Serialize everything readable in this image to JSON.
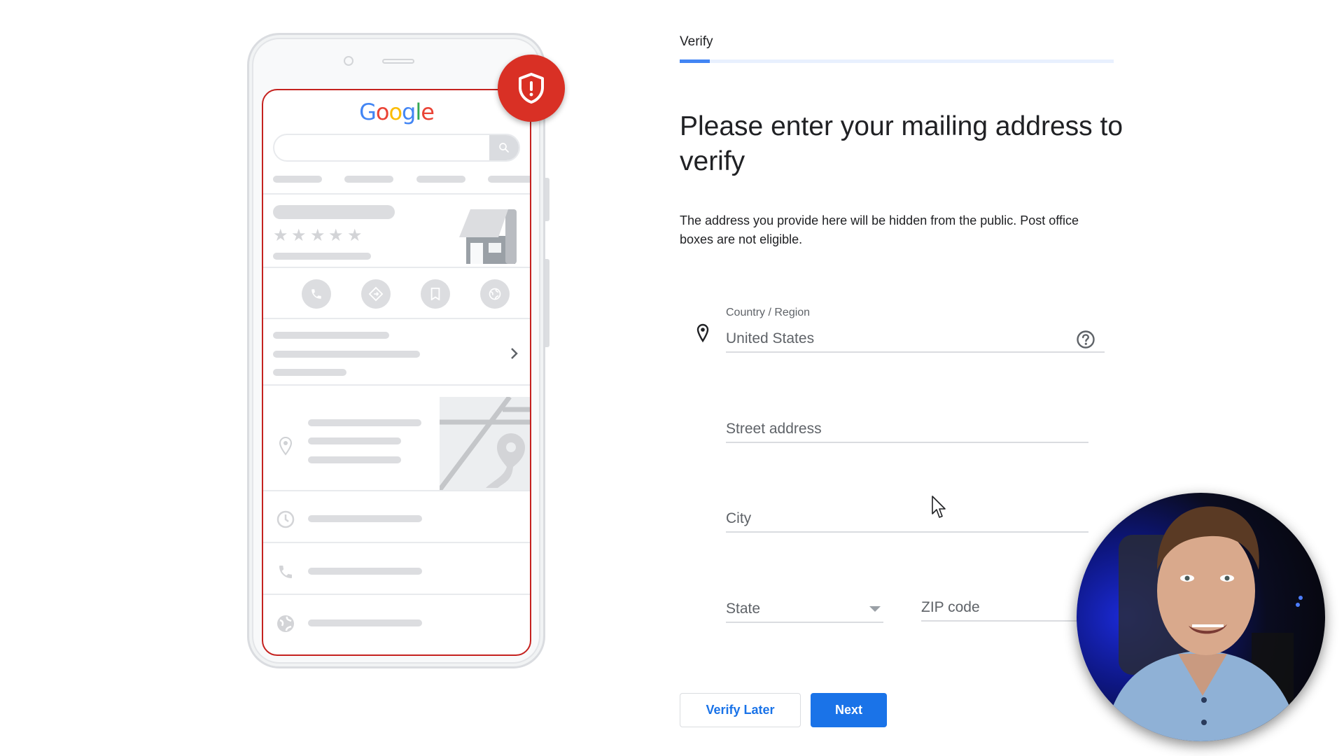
{
  "illustration": {
    "logo_letters": [
      {
        "char": "G",
        "color": "#4285f4"
      },
      {
        "char": "o",
        "color": "#ea4335"
      },
      {
        "char": "o",
        "color": "#fbbc05"
      },
      {
        "char": "g",
        "color": "#4285f4"
      },
      {
        "char": "l",
        "color": "#34a853"
      },
      {
        "char": "e",
        "color": "#ea4335"
      }
    ],
    "rating_stars": [
      "★",
      "★",
      "★",
      "★",
      "★"
    ],
    "badge_icon": "shield-alert-icon",
    "action_icons": [
      "phone-icon",
      "directions-icon",
      "bookmark-icon",
      "globe-icon"
    ],
    "info_row_icons": [
      "location-pin-icon",
      "clock-icon",
      "phone-icon",
      "globe-icon"
    ],
    "accent_color": "#d93025"
  },
  "form": {
    "step_label": "Verify",
    "progress_percent": 7,
    "title": "Please enter your mailing address to verify",
    "description": "The address you provide here will be hidden from the public. Post office boxes are not eligible.",
    "fields": {
      "country": {
        "label": "Country / Region",
        "value": "United States",
        "icon": "location-pin-icon",
        "help_icon": "help-circle-icon"
      },
      "street": {
        "placeholder": "Street address",
        "value": ""
      },
      "city": {
        "placeholder": "City",
        "value": ""
      },
      "state": {
        "placeholder": "State",
        "value": ""
      },
      "zip": {
        "placeholder": "ZIP code",
        "value": ""
      }
    },
    "buttons": {
      "secondary": "Verify Later",
      "primary": "Next"
    },
    "primary_color": "#1a73e8"
  },
  "overlay": {
    "webcam": "presenter-webcam"
  }
}
